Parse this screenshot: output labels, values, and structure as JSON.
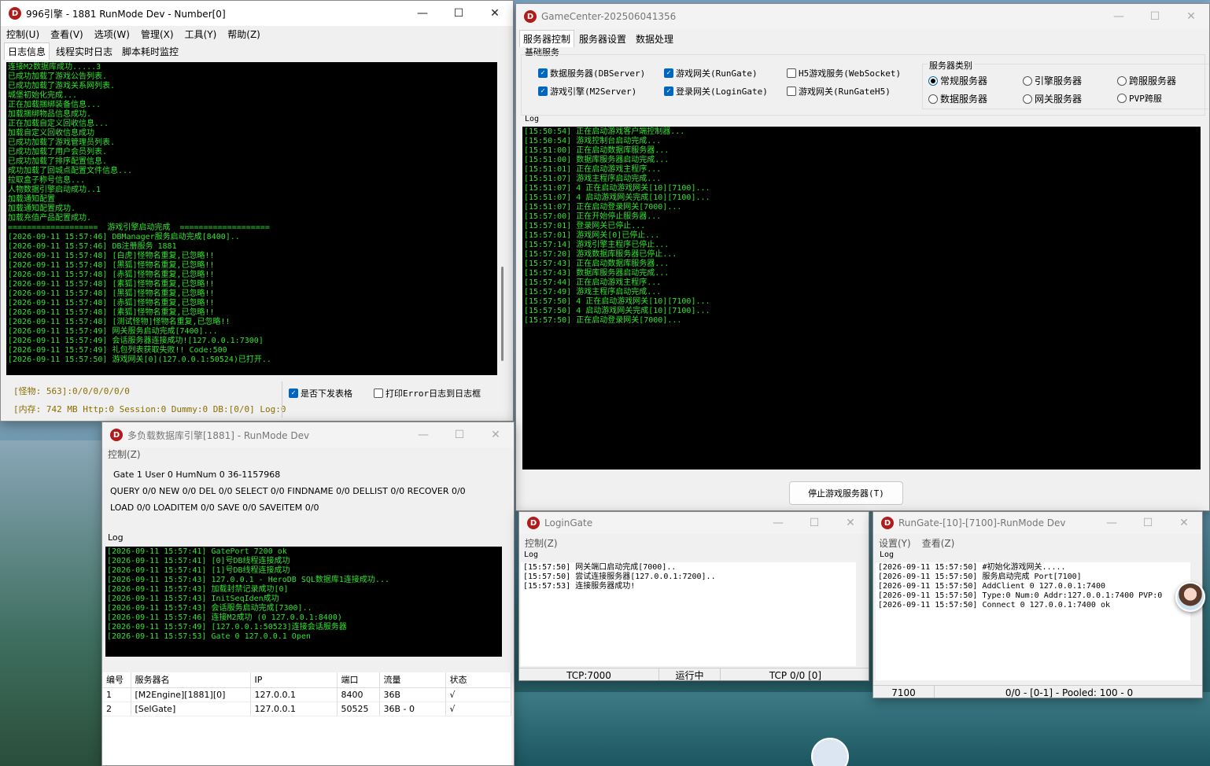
{
  "w1": {
    "title": "996引擎 - 1881 RunMode Dev - Number[0]",
    "menu": [
      "控制(U)",
      "查看(V)",
      "选项(W)",
      "管理(X)",
      "工具(Y)",
      "帮助(Z)"
    ],
    "tabs": [
      "日志信息",
      "线程实时日志",
      "脚本耗时监控"
    ],
    "log": [
      "连接M2数据库成功.....3",
      "已成功加载了游戏公告列表.",
      "已成功加载了游戏关系网列表.",
      "城堡初始化完成...",
      "正在加载捆绑装备信息...",
      "加载捆绑物品信息成功.",
      "正在加载自定义回收信息...",
      "加载自定义回收信息成功",
      "已成功加载了游戏管理员列表.",
      "已成功加载了用户会员列表.",
      "已成功加载了排序配置信息.",
      "成功加载了回城点配置文件信息...",
      "拉取盒子称号信息...",
      "人物数据引擎启动成功..1",
      "加载通知配置",
      "加载通知配置成功.",
      "加载充值产品配置成功.",
      "===================  游戏引擎启动完成  ===================",
      "[2026-09-11 15:57:46] DBManager服务启动完成[8400]..",
      "[2026-09-11 15:57:46] DB注册服务 1881",
      "[2026-09-11 15:57:48] [白虎]怪物名重复,已忽略!!",
      "[2026-09-11 15:57:48] [黑狐]怪物名重复,已忽略!!",
      "[2026-09-11 15:57:48] [赤狐]怪物名重复,已忽略!!",
      "[2026-09-11 15:57:48] [素狐]怪物名重复,已忽略!!",
      "[2026-09-11 15:57:48] [黑狐]怪物名重复,已忽略!!",
      "[2026-09-11 15:57:48] [赤狐]怪物名重复,已忽略!!",
      "[2026-09-11 15:57:48] [素狐]怪物名重复,已忽略!!",
      "[2026-09-11 15:57:48] [测试怪物]怪物名重复,已忽略!!",
      "[2026-09-11 15:57:49] 网关服务启动完成[7400]...",
      "[2026-09-11 15:57:49] 会话服务器连接成功![127.0.0.1:7300]",
      "[2026-09-11 15:57:49] 礼包列表获取失败!! Code:500",
      "[2026-09-11 15:57:50] 游戏网关[0](127.0.0.1:50524)已打开.."
    ],
    "status_monsters": "[怪物: 563]:0/0/0/0/0/0",
    "status_memory": "[内存: 742 MB Http:0 Session:0 Dummy:0 DB:[0/0] Log:0",
    "chk_table": "是否下发表格",
    "chk_error": "打印Error日志到日志框"
  },
  "w2": {
    "title": "GameCenter-202506041356",
    "tabs": [
      "服务器控制",
      "服务器设置",
      "数据处理"
    ],
    "group_basic": "基础服务",
    "services": [
      {
        "label": "数据服务器(DBServer)",
        "checked": true
      },
      {
        "label": "游戏网关(RunGate)",
        "checked": true
      },
      {
        "label": "H5游戏服务(WebSocket)",
        "checked": false
      },
      {
        "label": "游戏引擎(M2Server)",
        "checked": true
      },
      {
        "label": "登录网关(LoginGate)",
        "checked": true
      },
      {
        "label": "游戏网关(RunGateH5)",
        "checked": false
      }
    ],
    "group_type": "服务器类别",
    "types": [
      {
        "label": "常规服务器",
        "selected": true
      },
      {
        "label": "引擎服务器",
        "selected": false
      },
      {
        "label": "跨服服务器",
        "selected": false
      },
      {
        "label": "数据服务器",
        "selected": false
      },
      {
        "label": "网关服务器",
        "selected": false
      },
      {
        "label": "PVP跨服",
        "selected": false
      }
    ],
    "log_label": "Log",
    "log": [
      "[15:50:54] 正在启动游戏客户端控制器...",
      "[15:50:54] 游戏控制台启动完成...",
      "[15:51:00] 正在启动数据库服务器...",
      "[15:51:00] 数据库服务器启动完成...",
      "[15:51:01] 正在启动游戏主程序...",
      "[15:51:07] 游戏主程序启动完成...",
      "[15:51:07] 4 正在启动游戏网关[10][7100]...",
      "[15:51:07] 4 启动游戏网关完成[10][7100]...",
      "[15:51:07] 正在启动登录网关[7000]...",
      "[15:57:00] 正在开始停止服务器...",
      "[15:57:01] 登录网关已停止...",
      "[15:57:01] 游戏网关[0]已停止...",
      "[15:57:14] 游戏引擎主程序已停止...",
      "[15:57:20] 游戏数据库服务器已停止...",
      "[15:57:43] 正在启动数据库服务器...",
      "[15:57:43] 数据库服务器启动完成...",
      "[15:57:44] 正在启动游戏主程序...",
      "[15:57:49] 游戏主程序启动完成...",
      "[15:57:50] 4 正在启动游戏网关[10][7100]...",
      "[15:57:50] 4 启动游戏网关完成[10][7100]...",
      "[15:57:50] 正在启动登录网关[7000]..."
    ],
    "stop_button": "停止游戏服务器(T)"
  },
  "w3": {
    "title": "多负载数据库引擎[1881] - RunMode Dev",
    "menu": [
      "控制(Z)"
    ],
    "stats": [
      "Gate 1 User 0 HumNum 0 36-1157968",
      "QUERY 0/0 NEW 0/0 DEL 0/0 SELECT 0/0 FINDNAME 0/0 DELLIST 0/0 RECOVER 0/0",
      "LOAD 0/0 LOADITEM 0/0 SAVE 0/0 SAVEITEM 0/0"
    ],
    "log_label": "Log",
    "log": [
      "[2026-09-11 15:57:41] GatePort 7200 ok",
      "[2026-09-11 15:57:41] [0]号DB线程连接成功",
      "[2026-09-11 15:57:41] [1]号DB线程连接成功",
      "[2026-09-11 15:57:43] 127.0.0.1 - HeroDB SQL数据库1连接成功...",
      "[2026-09-11 15:57:43] 加载封禁记录成功[0]",
      "[2026-09-11 15:57:43] InitSeqIden成功",
      "[2026-09-11 15:57:43] 会话服务启动完成[7300]..",
      "[2026-09-11 15:57:46] 连接M2成功 (0 127.0.0.1:8400)",
      "[2026-09-11 15:57:49] [127.0.0.1:50523]连接会话服务器",
      "[2026-09-11 15:57:53] Gate 0 127.0.0.1 Open"
    ],
    "table": {
      "headers": [
        "编号",
        "服务器名",
        "IP",
        "端口",
        "流量",
        "状态"
      ],
      "rows": [
        [
          "1",
          "[M2Engine][1881][0]",
          "127.0.0.1",
          "8400",
          "36B",
          "√"
        ],
        [
          "2",
          "[SelGate]",
          "127.0.0.1",
          "50525",
          "36B - 0",
          "√"
        ]
      ]
    }
  },
  "w4": {
    "title": "LoginGate",
    "menu": [
      "控制(Z)"
    ],
    "log_label": "Log",
    "log": [
      "[15:57:50] 网关端口启动完成[7000]..",
      "[15:57:50] 尝试连接服务器[127.0.0.1:7200]..",
      "[15:57:53] 连接服务器成功!"
    ],
    "status": [
      "TCP:7000",
      "运行中",
      "TCP 0/0 [0]"
    ]
  },
  "w5": {
    "title": "RunGate-[10]-[7100]-RunMode Dev",
    "menu": [
      "设置(Y)",
      "查看(Z)"
    ],
    "log_label": "Log",
    "log": [
      "[2026-09-11 15:57:50] #初始化游戏网关.....",
      "[2026-09-11 15:57:50] 服务启动完成 Port[7100]",
      "[2026-09-11 15:57:50] AddClient 0 127.0.0.1:7400",
      "[2026-09-11 15:57:50] Type:0 Num:0 Addr:127.0.0.1:7400 PVP:0",
      "[2026-09-11 15:57:50] Connect 0 127.0.0.1:7400 ok"
    ],
    "status": [
      "7100",
      "0/0 - [0-1]  - Pooled: 100 - 0"
    ]
  },
  "icons": {
    "app": "D",
    "minimize": "—",
    "maximize": "☐",
    "close": "✕",
    "check": "✓"
  }
}
